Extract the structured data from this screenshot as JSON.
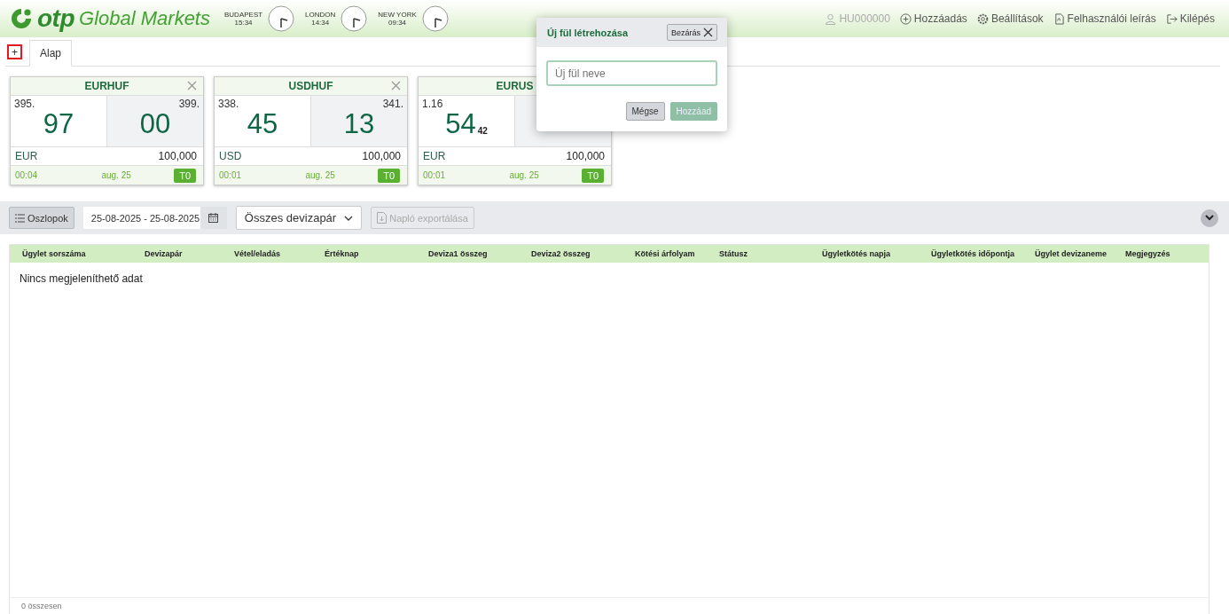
{
  "header": {
    "logo": {
      "brand": "otp",
      "product": "Global Markets"
    },
    "clocks": [
      {
        "city": "BUDAPEST",
        "time": "15:34"
      },
      {
        "city": "LONDON",
        "time": "14:34"
      },
      {
        "city": "NEW YORK",
        "time": "09:34"
      }
    ],
    "user": "HU000000",
    "links": [
      {
        "label": "Hozzáadás",
        "kind": "add"
      },
      {
        "label": "Beállítások",
        "kind": "settings"
      },
      {
        "label": "Felhasználói leírás",
        "kind": "manual"
      },
      {
        "label": "Kilépés",
        "kind": "logout"
      }
    ]
  },
  "tabs": {
    "add": {
      "label": "+",
      "focused": true
    },
    "items": [
      {
        "label": "Alap",
        "selected": true
      }
    ]
  },
  "cards": [
    {
      "pair": "EURHUF",
      "bid": {
        "big": "395.",
        "main": "97"
      },
      "ask": {
        "big": "399.",
        "main": "00"
      },
      "currency": "EUR",
      "amount": "100,000",
      "timer": "00:04",
      "date": "aug. 25",
      "tenor": "T0"
    },
    {
      "pair": "USDHUF",
      "bid": {
        "big": "338.",
        "main": "45"
      },
      "ask": {
        "big": "341.",
        "main": "13"
      },
      "currency": "USD",
      "amount": "100,000",
      "timer": "00:01",
      "date": "aug. 25",
      "tenor": "T0"
    },
    {
      "pair": "EURUS",
      "bid": {
        "big": "1.16",
        "main": "54",
        "pip": "42"
      },
      "currency": "EUR",
      "amount": "100,000",
      "timer": "00:01",
      "date": "aug. 25",
      "tenor": "T0"
    }
  ],
  "dialog": {
    "title": "Új fül létrehozása",
    "close": "Bezárás",
    "placeholder": "Új fül neve",
    "buttons": [
      {
        "label": "Mégse",
        "disabled": false
      },
      {
        "label": "Hozzáad",
        "disabled": true
      }
    ]
  },
  "toolbar": {
    "columns": "Oszlopok",
    "date_range": "25-08-2025 - 25-08-2025",
    "pair_filter": "Összes devizapár",
    "export": {
      "label": "Napló exportálása",
      "disabled": true
    }
  },
  "table": {
    "columns": [
      "Ügylet sorszáma",
      "Devizapár",
      "Vétel/eladás",
      "Értéknap",
      "Deviza1 összeg",
      "Deviza2 összeg",
      "Kötési árfolyam",
      "Státusz",
      "Ügyletkötés napja",
      "Ügyletkötés időpontja",
      "Ügylet devizaneme",
      "Megjegyzés"
    ],
    "empty": "Nincs megjeleníthető adat",
    "footer": "0 összesen"
  }
}
